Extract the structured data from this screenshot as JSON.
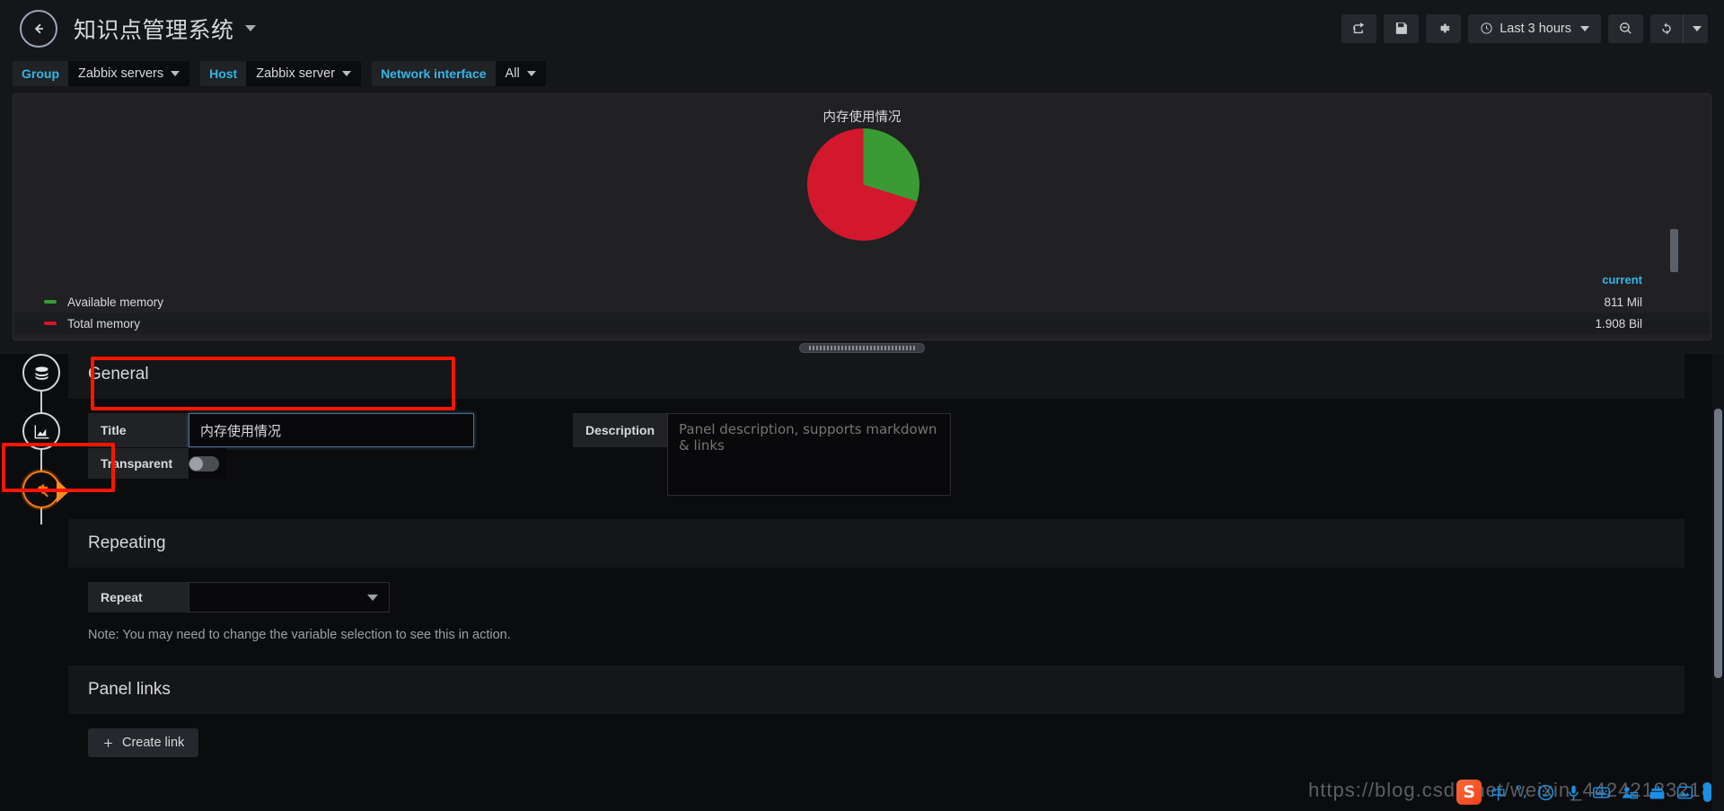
{
  "navbar": {
    "back_icon": "arrow-left-circle-icon",
    "dashboard_title": "知识点管理系统",
    "title_caret_icon": "chevron-down-icon",
    "actions": [
      {
        "name": "share-dashboard-button",
        "icon": "share-square-icon"
      },
      {
        "name": "save-dashboard-button",
        "icon": "floppy-disk-icon"
      },
      {
        "name": "dashboard-settings-button",
        "icon": "gear-icon"
      }
    ],
    "time_picker": {
      "icon": "clock-icon",
      "label": "Last 3 hours",
      "caret_icon": "chevron-down-icon"
    },
    "zoom_out_button": {
      "icon": "search-minus-icon"
    },
    "refresh_button": {
      "icon": "refresh-icon"
    },
    "refresh_interval_caret": {
      "icon": "chevron-down-icon"
    }
  },
  "variables": [
    {
      "label": "Group",
      "value": "Zabbix servers"
    },
    {
      "label": "Host",
      "value": "Zabbix server"
    },
    {
      "label": "Network interface",
      "value": "All"
    }
  ],
  "panel_preview": {
    "title": "内存使用情况",
    "legend_header": "current",
    "legend": [
      {
        "name": "Available memory",
        "value": "811 Mil",
        "color": "#3a9a33"
      },
      {
        "name": "Total memory",
        "value": "1.908 Bil",
        "color": "#d3172c"
      }
    ]
  },
  "chart_data": {
    "type": "pie",
    "title": "内存使用情况",
    "labels": [
      "Available memory",
      "Total memory"
    ],
    "values": [
      811,
      1908
    ],
    "value_labels": [
      "811 Mil",
      "1.908 Bil"
    ],
    "colors": [
      "#3a9a33",
      "#d3172c"
    ],
    "percentages": [
      29.8,
      70.2
    ],
    "legend_position": "bottom",
    "legend_columns": [
      "current"
    ],
    "grid": false
  },
  "edit_rail": [
    {
      "name": "queries-tab",
      "icon": "database-icon",
      "active": false
    },
    {
      "name": "visualization-tab",
      "icon": "chart-area-icon",
      "active": false
    },
    {
      "name": "general-settings-tab",
      "icon": "gear-wrench-icon",
      "active": true
    }
  ],
  "sections": {
    "general": {
      "heading": "General",
      "title_label": "Title",
      "title_value": "内存使用情况",
      "transparent_label": "Transparent",
      "transparent_on": false,
      "description_label": "Description",
      "description_value": "",
      "description_placeholder": "Panel description, supports markdown & links"
    },
    "repeating": {
      "heading": "Repeating",
      "repeat_label": "Repeat",
      "repeat_value": "",
      "repeat_caret_icon": "chevron-down-icon",
      "note": "Note: You may need to change the variable selection to see this in action."
    },
    "panel_links": {
      "heading": "Panel links",
      "create_link_label": "Create link",
      "create_link_icon": "plus-icon"
    }
  },
  "resize_handle": {
    "name": "panel-resize-handle"
  },
  "watermark": "https://blog.csdn.net/weixin_44242133218",
  "ime": {
    "logo": "S",
    "items": [
      {
        "name": "ime-language-icon",
        "glyph": "中"
      },
      {
        "name": "ime-punctuation-icon",
        "glyph": "°,"
      },
      {
        "name": "ime-emoji-icon",
        "glyph": "☺"
      },
      {
        "name": "ime-voice-icon",
        "glyph": "🎤"
      },
      {
        "name": "ime-keyboard-icon",
        "glyph": "⌨"
      },
      {
        "name": "ime-user-icon",
        "glyph": "👤"
      },
      {
        "name": "ime-toolbox-icon",
        "glyph": "🧰"
      },
      {
        "name": "ime-skin-icon",
        "glyph": "🖼"
      }
    ]
  }
}
